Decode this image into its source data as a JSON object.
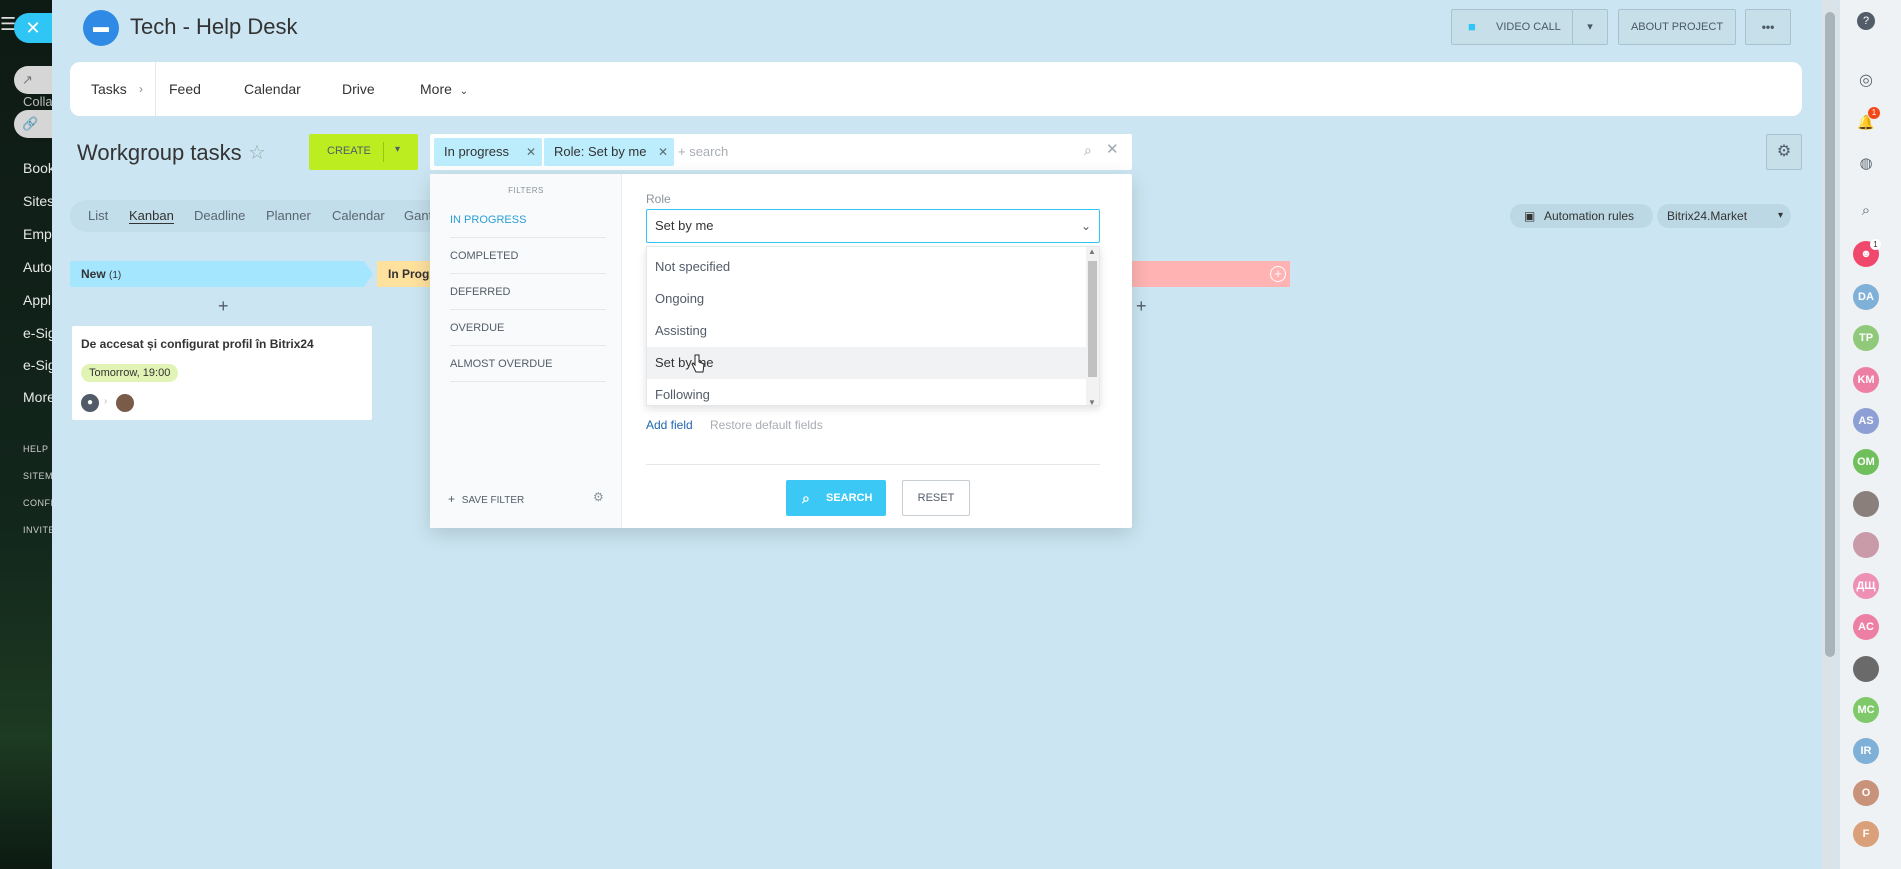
{
  "left_sidebar": {
    "items": [
      "Colla",
      "Book",
      "Sites",
      "Empl",
      "Auto",
      "Appl",
      "e-Sig",
      "e-Sig",
      "More"
    ],
    "small_items": [
      "HELP",
      "SITEMA",
      "CONFI",
      "INVITE"
    ]
  },
  "header": {
    "title": "Tech - Help Desk",
    "video_call": "VIDEO CALL",
    "about_project": "ABOUT PROJECT",
    "more_dots": "•••"
  },
  "nav": {
    "items": [
      "Tasks",
      "Feed",
      "Calendar",
      "Drive",
      "More"
    ]
  },
  "toolbar": {
    "page_title": "Workgroup tasks",
    "create_label": "CREATE",
    "chips": [
      "In progress",
      "Role: Set by me"
    ],
    "search_placeholder": "+ search"
  },
  "view_tabs": [
    "List",
    "Kanban",
    "Deadline",
    "Planner",
    "Calendar",
    "Gant"
  ],
  "right_actions": {
    "automation": "Automation rules",
    "market": "Bitrix24.Market"
  },
  "kanban": {
    "columns": [
      {
        "label": "New",
        "count": "(1)",
        "color": "#a5e6ff"
      },
      {
        "label": "In Progr",
        "color": "#ffe19e"
      }
    ],
    "card": {
      "title": "De accesat și configurat profil în Bitrix24",
      "deadline": "Tomorrow, 19:00"
    }
  },
  "filter_popup": {
    "presets_header": "FILTERS",
    "presets": [
      "IN PROGRESS",
      "COMPLETED",
      "DEFERRED",
      "OVERDUE",
      "ALMOST OVERDUE"
    ],
    "save_filter": "SAVE FILTER",
    "role_label": "Role",
    "role_value": "Set by me",
    "role_options": [
      "Not specified",
      "Ongoing",
      "Assisting",
      "Set by me",
      "Following"
    ],
    "add_field": "Add field",
    "restore_fields": "Restore default fields",
    "search_button": "SEARCH",
    "reset_button": "RESET"
  },
  "right_bar": {
    "notification_count": "1",
    "contacts_count": "1",
    "avatars": [
      {
        "initials": "DA",
        "color": "#7fb0d8"
      },
      {
        "initials": "TP",
        "color": "#90c97a"
      },
      {
        "initials": "KM",
        "color": "#ee7fa4"
      },
      {
        "initials": "AS",
        "color": "#8e9fd6"
      },
      {
        "initials": "OM",
        "color": "#6fbf5c"
      },
      {
        "initials": "",
        "color": "#8a7f7a"
      },
      {
        "initials": "",
        "color": "#c99aa8"
      },
      {
        "initials": "ДЩ",
        "color": "#ee8fb4"
      },
      {
        "initials": "AC",
        "color": "#ee7fa4"
      },
      {
        "initials": "",
        "color": "#6a6a6a"
      },
      {
        "initials": "MC",
        "color": "#7fc96a"
      },
      {
        "initials": "IR",
        "color": "#7fb0d8"
      },
      {
        "initials": "O",
        "color": "#c9927a"
      },
      {
        "initials": "F",
        "color": "#d9a07a"
      }
    ]
  }
}
